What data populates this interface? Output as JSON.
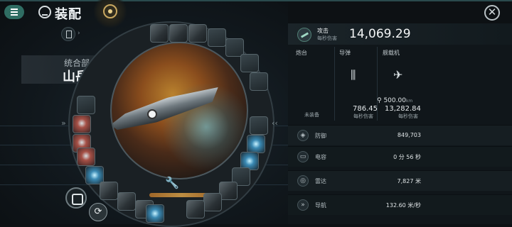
{
  "header": {
    "title": "装配"
  },
  "ship": {
    "faction": "统合部",
    "name": "山岳级",
    "name_arrow": "»"
  },
  "side_arrows": {
    "left": "»",
    "right": "‹‹"
  },
  "attack": {
    "label": "攻击",
    "sublabel": "每秒伤害",
    "value": "14,069.29"
  },
  "weapon_columns": [
    {
      "label": "炮台",
      "status": "未装备",
      "icon": "turret-icon"
    },
    {
      "label": "导弹",
      "value": "786.45",
      "sublabel": "每秒伤害",
      "icon": "missile-icon"
    },
    {
      "label": "舰载机",
      "value": "13,282.84",
      "sublabel": "每秒伤害",
      "icon": "fighter-icon",
      "range": "500.00",
      "range_unit": "km"
    }
  ],
  "stats": [
    {
      "label": "防御",
      "value": "849,703",
      "icon": "shield-icon"
    },
    {
      "label": "电容",
      "value": "0 分 56 秒",
      "icon": "capacitor-icon"
    },
    {
      "label": "雷达",
      "value": "7,827 米",
      "icon": "radar-icon"
    },
    {
      "label": "导航",
      "value": "132.60 米/秒",
      "icon": "navigation-icon"
    }
  ],
  "colors": {
    "accent": "#2f6d63",
    "gold": "#c9a861",
    "panel": "#10161a"
  }
}
